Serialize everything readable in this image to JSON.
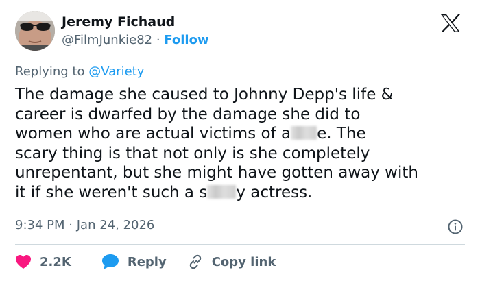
{
  "author": {
    "name": "Jeremy Fichaud",
    "handle": "@FilmJunkie82",
    "separator": "·",
    "follow_label": "Follow"
  },
  "reply_context": {
    "prefix": "Replying to",
    "mention": "@Variety"
  },
  "tweet": {
    "line1": "The damage she caused to Johnny Depp's life &",
    "line2": "career is dwarfed by the damage she did to",
    "line3_before": "women who are actual victims of a",
    "line3_after": "e.  The",
    "line4": "scary thing is that not only is she completely",
    "line5": "unrepentant, but she might have gotten away with",
    "line6_before": "it if she weren't such a s",
    "line6_after": "y actress."
  },
  "meta": {
    "time": "9:34 PM",
    "separator": "·",
    "date": "Jan 24, 2026"
  },
  "actions": {
    "likes": "2.2K",
    "reply_label": "Reply",
    "copy_link_label": "Copy link"
  },
  "icons": {
    "logo": "x-logo-icon",
    "info": "info-icon",
    "like": "heart-icon",
    "reply": "speech-bubble-icon",
    "copy": "link-icon"
  },
  "colors": {
    "text": "#0f1419",
    "secondary": "#536471",
    "accent": "#1d9bf0",
    "like": "#f91880",
    "divider": "#cfd9de"
  }
}
